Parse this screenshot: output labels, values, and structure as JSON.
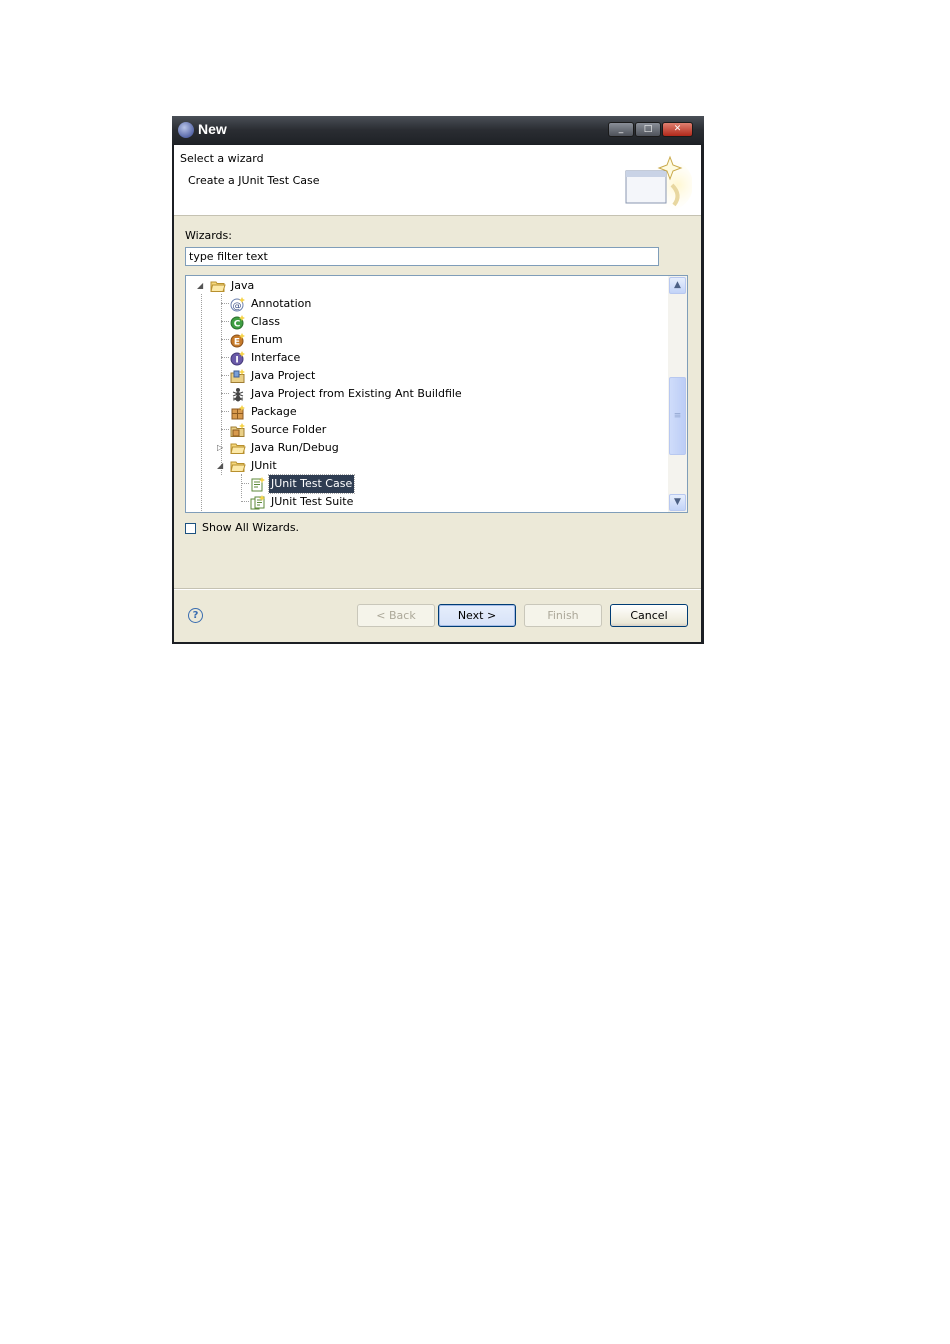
{
  "window": {
    "title": "New",
    "min_glyph": "_",
    "max_glyph": "□",
    "close_glyph": "✕"
  },
  "header": {
    "title": "Select a wizard",
    "message": "Create a JUnit Test Case"
  },
  "wizards": {
    "label": "Wizards:",
    "filter_value": "type filter text",
    "tree": [
      {
        "label": "Java",
        "icon": "folder-open-icon",
        "expanded": true
      },
      {
        "label": "Annotation",
        "icon": "annotation-icon"
      },
      {
        "label": "Class",
        "icon": "class-icon"
      },
      {
        "label": "Enum",
        "icon": "enum-icon"
      },
      {
        "label": "Interface",
        "icon": "interface-icon"
      },
      {
        "label": "Java Project",
        "icon": "java-project-icon"
      },
      {
        "label": "Java Project from Existing Ant Buildfile",
        "icon": "ant-icon"
      },
      {
        "label": "Package",
        "icon": "package-icon"
      },
      {
        "label": "Source Folder",
        "icon": "source-folder-icon"
      },
      {
        "label": "Java Run/Debug",
        "icon": "folder-icon",
        "expanded": false
      },
      {
        "label": "JUnit",
        "icon": "folder-open-icon",
        "expanded": true
      },
      {
        "label": "JUnit Test Case",
        "icon": "junit-test-case-icon",
        "selected": true
      },
      {
        "label": "JUnit Test Suite",
        "icon": "junit-test-suite-icon"
      }
    ]
  },
  "show_all": {
    "label": "Show All Wizards.",
    "checked": false
  },
  "buttons": {
    "help": "?",
    "back": "< Back",
    "next": "Next >",
    "finish": "Finish",
    "cancel": "Cancel"
  },
  "scrollbar": {
    "up": "▲",
    "down": "▼",
    "grip": "≡"
  },
  "colors": {
    "selection": "#2f3d52",
    "dialog_bg": "#ece9d8",
    "titlebar": "#2a2d32"
  }
}
